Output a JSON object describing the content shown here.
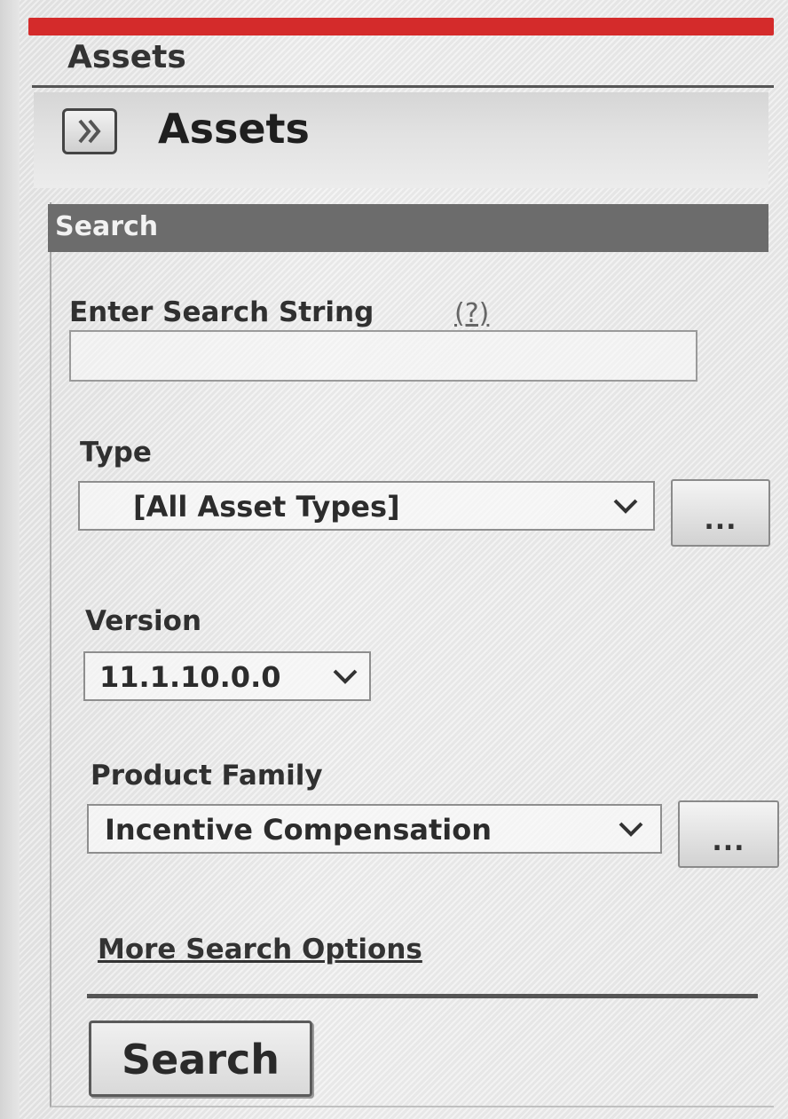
{
  "page": {
    "section_title": "Assets",
    "panel_title": "Assets",
    "expand_icon": "double-chevron-right-icon"
  },
  "search": {
    "header": "Search",
    "search_string_label": "Enter Search String",
    "help_link": "(?)",
    "search_string_value": "",
    "type_label": "Type",
    "type_value": "[All Asset Types]",
    "type_more_label": "...",
    "version_label": "Version",
    "version_value": "11.1.10.0.0",
    "product_family_label": "Product Family",
    "product_family_value": "Incentive Compensation",
    "product_family_more_label": "...",
    "more_options_link": "More Search Options",
    "submit_label": "Search"
  },
  "colors": {
    "accent_bar": "#d42b2b",
    "search_header_bg": "#6c6c6c"
  }
}
